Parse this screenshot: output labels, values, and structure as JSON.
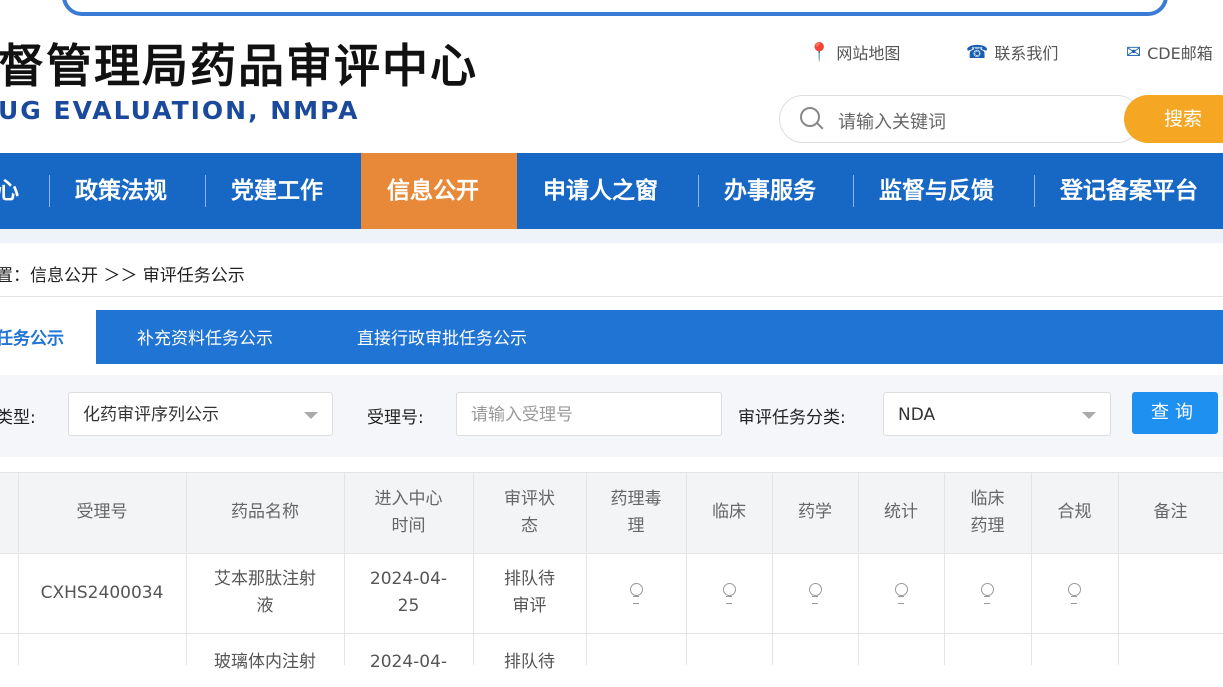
{
  "header": {
    "title_cn": "督管理局药品审评中心",
    "title_en": "UG EVALUATION, NMPA",
    "links": [
      {
        "label": "网站地图",
        "icon": "map-pin-icon"
      },
      {
        "label": "联系我们",
        "icon": "phone-icon"
      },
      {
        "label": "CDE邮箱",
        "icon": "mail-icon"
      }
    ],
    "search_placeholder": "请输入关键词",
    "search_button": "搜索"
  },
  "nav": {
    "items": [
      "心",
      "政策法规",
      "党建工作",
      "信息公开",
      "申请人之窗",
      "办事服务",
      "监督与反馈",
      "登记备案平台"
    ],
    "active": "信息公开"
  },
  "breadcrumb": {
    "text": "置：信息公开 ＞＞ 审评任务公示"
  },
  "tabs": [
    "任务公示",
    "补充资料任务公示",
    "直接行政审批任务公示"
  ],
  "filters": {
    "type_label": "类型:",
    "type_value": "化药审评序列公示",
    "accept_label": "受理号:",
    "accept_placeholder": "请输入受理号",
    "category_label": "审评任务分类:",
    "category_value": "NDA",
    "query_button": "查询"
  },
  "table": {
    "headers": [
      "受理号",
      "药品名称",
      "进入中心\n时间",
      "审评状\n态",
      "药理毒\n理",
      "临床",
      "药学",
      "统计",
      "临床\n药理",
      "合规",
      "备注"
    ],
    "rows": [
      {
        "accept_no": "CXHS2400034",
        "drug_name": "艾本那肽注射\n液",
        "date": "2024-04-\n25",
        "status": "排队待\n审评",
        "note": ""
      },
      {
        "accept_no": "",
        "drug_name": "玻璃体内注射",
        "date": "2024-04-",
        "status": "排队待",
        "note": ""
      }
    ]
  },
  "colors": {
    "nav": "#1767c5",
    "active": "#e8893a",
    "accent": "#f5a623",
    "tab": "#1f74d4"
  }
}
